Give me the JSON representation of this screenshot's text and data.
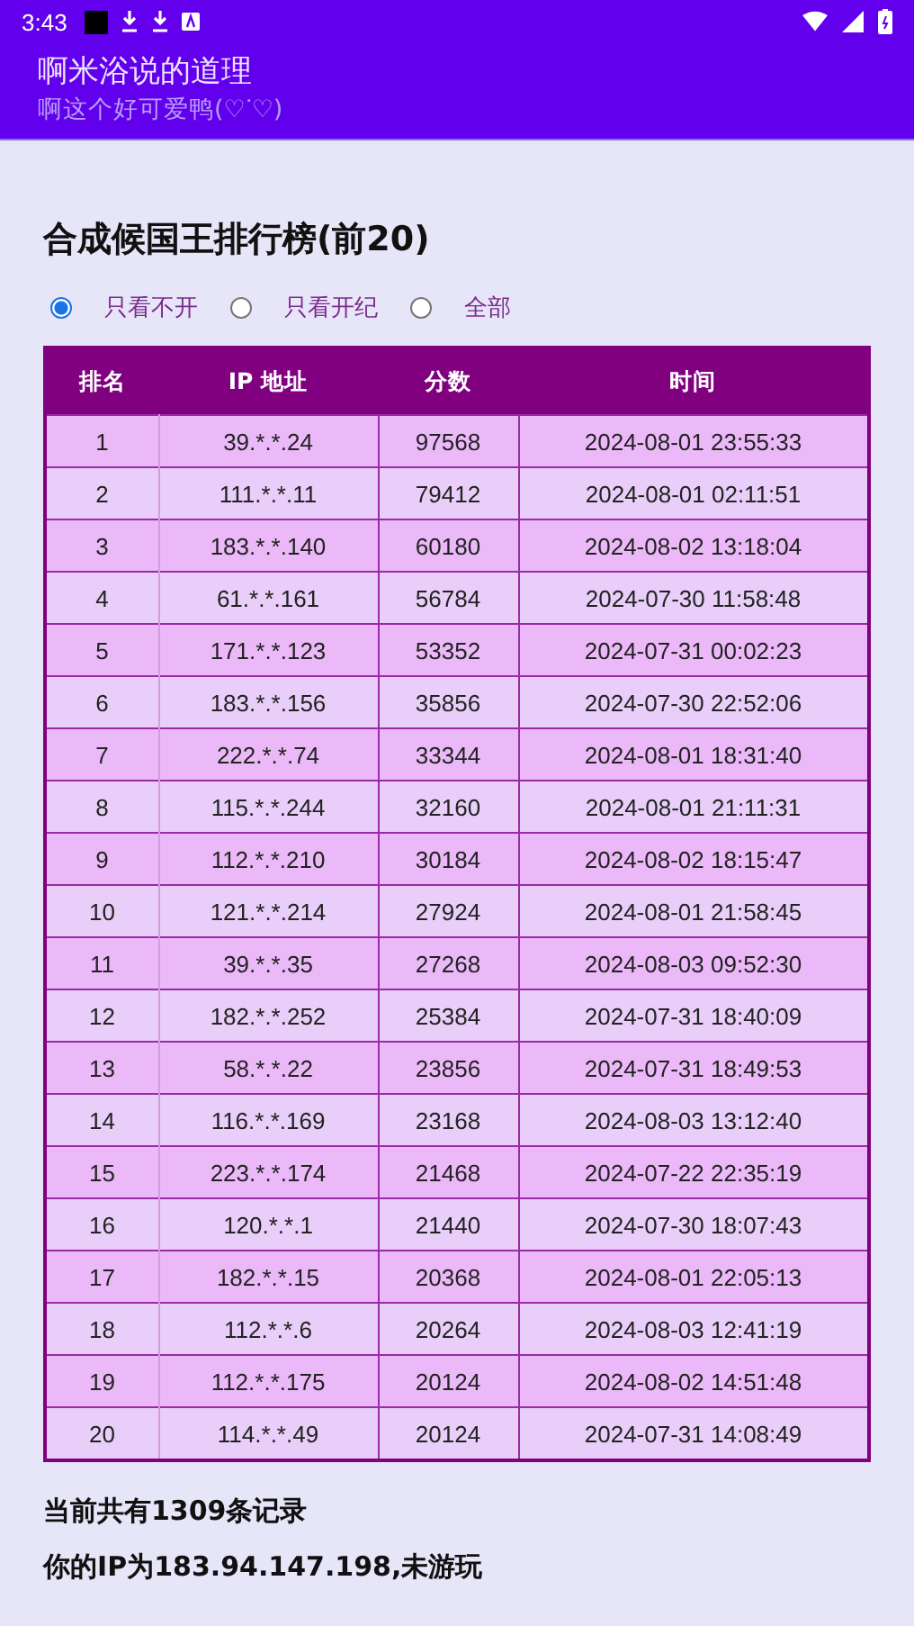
{
  "status_bar": {
    "time": "3:43"
  },
  "app_bar": {
    "title": "啊米浴说的道理",
    "subtitle": "啊这个好可爱鸭(♡ᐝ♡)"
  },
  "heading": "合成候国王排行榜(前20)",
  "filters": [
    {
      "label": "只看不开",
      "selected": true
    },
    {
      "label": "只看开纪",
      "selected": false
    },
    {
      "label": "全部",
      "selected": false
    }
  ],
  "table": {
    "columns": [
      "排名",
      "IP 地址",
      "分数",
      "时间"
    ],
    "rows": [
      [
        "1",
        "39.*.*.24",
        "97568",
        "2024-08-01 23:55:33"
      ],
      [
        "2",
        "111.*.*.11",
        "79412",
        "2024-08-01 02:11:51"
      ],
      [
        "3",
        "183.*.*.140",
        "60180",
        "2024-08-02 13:18:04"
      ],
      [
        "4",
        "61.*.*.161",
        "56784",
        "2024-07-30 11:58:48"
      ],
      [
        "5",
        "171.*.*.123",
        "53352",
        "2024-07-31 00:02:23"
      ],
      [
        "6",
        "183.*.*.156",
        "35856",
        "2024-07-30 22:52:06"
      ],
      [
        "7",
        "222.*.*.74",
        "33344",
        "2024-08-01 18:31:40"
      ],
      [
        "8",
        "115.*.*.244",
        "32160",
        "2024-08-01 21:11:31"
      ],
      [
        "9",
        "112.*.*.210",
        "30184",
        "2024-08-02 18:15:47"
      ],
      [
        "10",
        "121.*.*.214",
        "27924",
        "2024-08-01 21:58:45"
      ],
      [
        "11",
        "39.*.*.35",
        "27268",
        "2024-08-03 09:52:30"
      ],
      [
        "12",
        "182.*.*.252",
        "25384",
        "2024-07-31 18:40:09"
      ],
      [
        "13",
        "58.*.*.22",
        "23856",
        "2024-07-31 18:49:53"
      ],
      [
        "14",
        "116.*.*.169",
        "23168",
        "2024-08-03 13:12:40"
      ],
      [
        "15",
        "223.*.*.174",
        "21468",
        "2024-07-22 22:35:19"
      ],
      [
        "16",
        "120.*.*.1",
        "21440",
        "2024-07-30 18:07:43"
      ],
      [
        "17",
        "182.*.*.15",
        "20368",
        "2024-08-01 22:05:13"
      ],
      [
        "18",
        "112.*.*.6",
        "20264",
        "2024-08-03 12:41:19"
      ],
      [
        "19",
        "112.*.*.175",
        "20124",
        "2024-08-02 14:51:48"
      ],
      [
        "20",
        "114.*.*.49",
        "20124",
        "2024-07-31 14:08:49"
      ]
    ]
  },
  "record_count": "当前共有1309条记录",
  "your_ip": "你的IP为183.94.147.198,未游玩"
}
